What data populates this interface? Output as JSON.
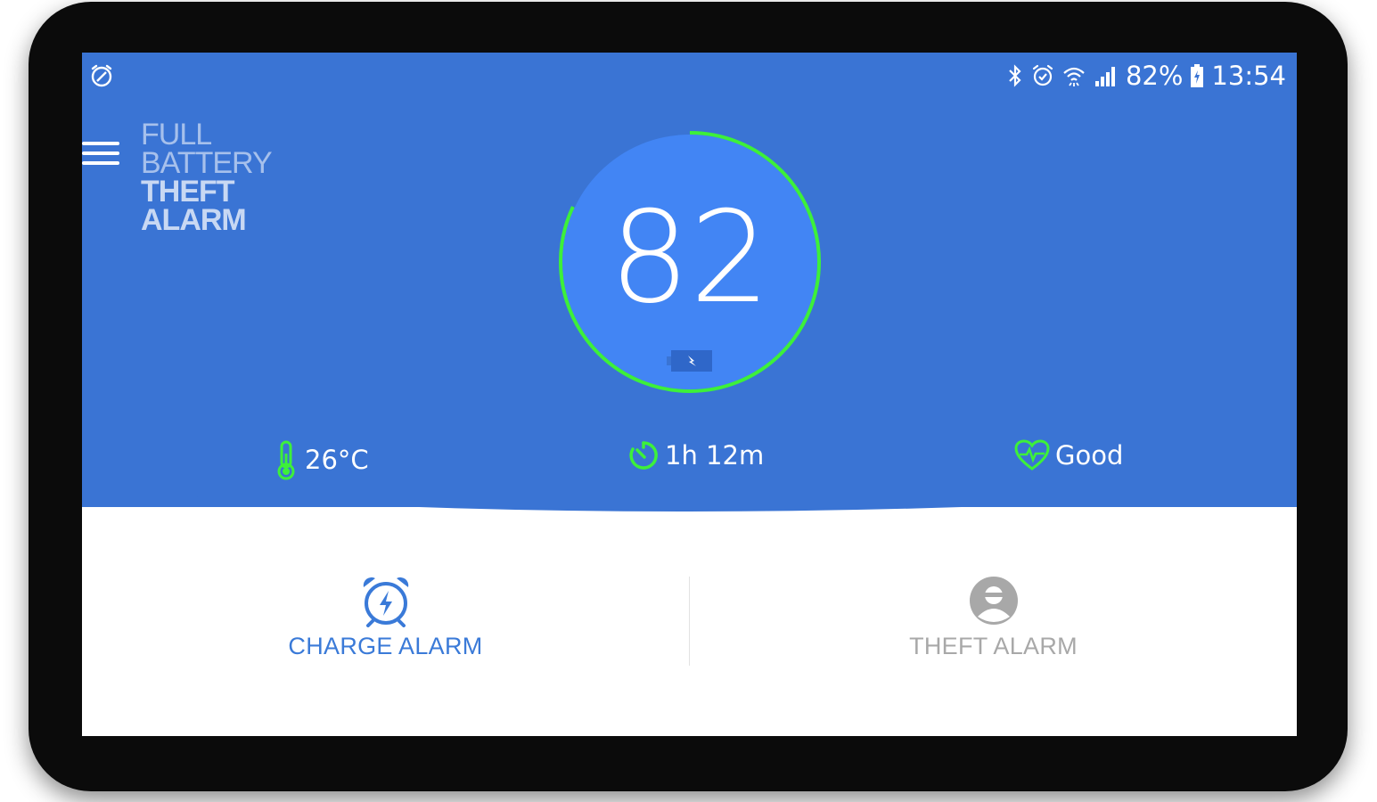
{
  "status_bar": {
    "battery_percent": "82%",
    "time": "13:54",
    "icons": [
      "alarm-icon",
      "bluetooth-icon",
      "alarm-clock-icon",
      "wifi-icon",
      "signal-icon",
      "battery-charging-icon"
    ]
  },
  "header": {
    "logo_line1": "FULL",
    "logo_line2": "BATTERY",
    "logo_line3": "THEFT",
    "logo_line4": "ALARM"
  },
  "gauge": {
    "value": "82",
    "level": 0.82,
    "ring_color": "#3df03a",
    "fill_color": "#4285f4"
  },
  "stats": {
    "temperature": "26°C",
    "time_remaining": "1h 12m",
    "health": "Good"
  },
  "cards": {
    "charge_alarm_label": "CHARGE ALARM",
    "theft_alarm_label": "THEFT ALARM"
  },
  "colors": {
    "background_blue": "#3a74d4",
    "accent_green": "#3df03a",
    "charge_blue": "#3a7ad8",
    "theft_gray": "#a8a8a8"
  }
}
